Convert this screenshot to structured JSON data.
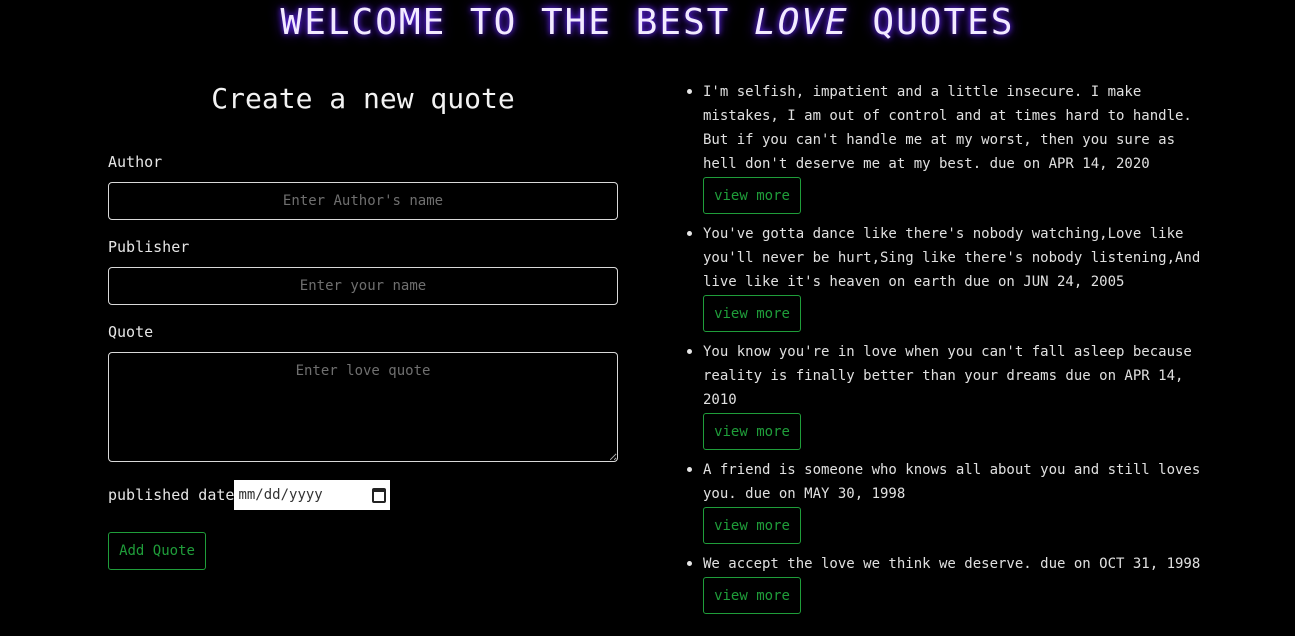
{
  "header": {
    "title_prefix": "WELCOME TO THE BEST",
    "title_emphasis": "LOVE",
    "title_suffix": "QUOTES"
  },
  "form": {
    "heading": "Create a new quote",
    "author_label": "Author",
    "author_placeholder": "Enter Author's name",
    "publisher_label": "Publisher",
    "publisher_placeholder": "Enter your name",
    "quote_label": "Quote",
    "quote_placeholder": "Enter love quote",
    "date_label": "published date",
    "date_value": "mm/dd/yyyy",
    "submit_label": "Add Quote",
    "accent_color": "#1f9d3a"
  },
  "quotes": [
    {
      "text": "I'm selfish, impatient and a little insecure. I make mistakes, I am out of control and at times hard to handle. But if you can't handle me at my worst, then you sure as hell don't deserve me at my best. due on APR 14, 2020",
      "button": "view more"
    },
    {
      "text": "You've gotta dance like there's nobody watching,Love like you'll never be hurt,Sing like there's nobody listening,And live like it's heaven on earth due on JUN 24, 2005",
      "button": "view more"
    },
    {
      "text": "You know you're in love when you can't fall asleep because reality is finally better than your dreams due on APR 14, 2010",
      "button": "view more"
    },
    {
      "text": "A friend is someone who knows all about you and still loves you. due on MAY 30, 1998",
      "button": "view more"
    },
    {
      "text": "We accept the love we think we deserve. due on OCT 31, 1998",
      "button": "view more"
    }
  ]
}
